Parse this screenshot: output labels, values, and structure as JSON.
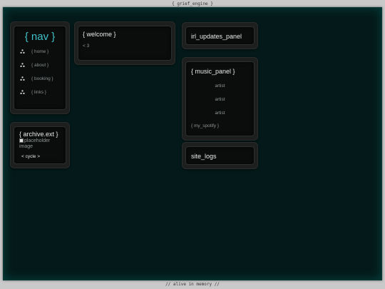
{
  "frame": {
    "top_label": "{ grief_engine }",
    "bottom_label": "// alive in memory //"
  },
  "nav": {
    "title": "{ nav }",
    "items": [
      {
        "label": "{ home }"
      },
      {
        "label": "{ about }"
      },
      {
        "label": "{ booking }"
      },
      {
        "label": "{ links }"
      }
    ]
  },
  "welcome": {
    "title": "{ welcome }",
    "text": "< 3"
  },
  "archive": {
    "title": "{ archive.ext }",
    "image_alt": "placeholder image",
    "cycle_label": "< cycle >"
  },
  "irl_updates": {
    "title": "irl_updates_panel"
  },
  "music": {
    "title": "{ music_panel }",
    "artists": [
      "artist",
      "artist",
      "artist"
    ],
    "spotify_link": "{ my_spotify }"
  },
  "site_logs": {
    "title": "site_logs"
  },
  "colors": {
    "accent": "#3ec3c8",
    "screen_bg": "#041a1a",
    "card_bg": "#1d1e1e"
  }
}
